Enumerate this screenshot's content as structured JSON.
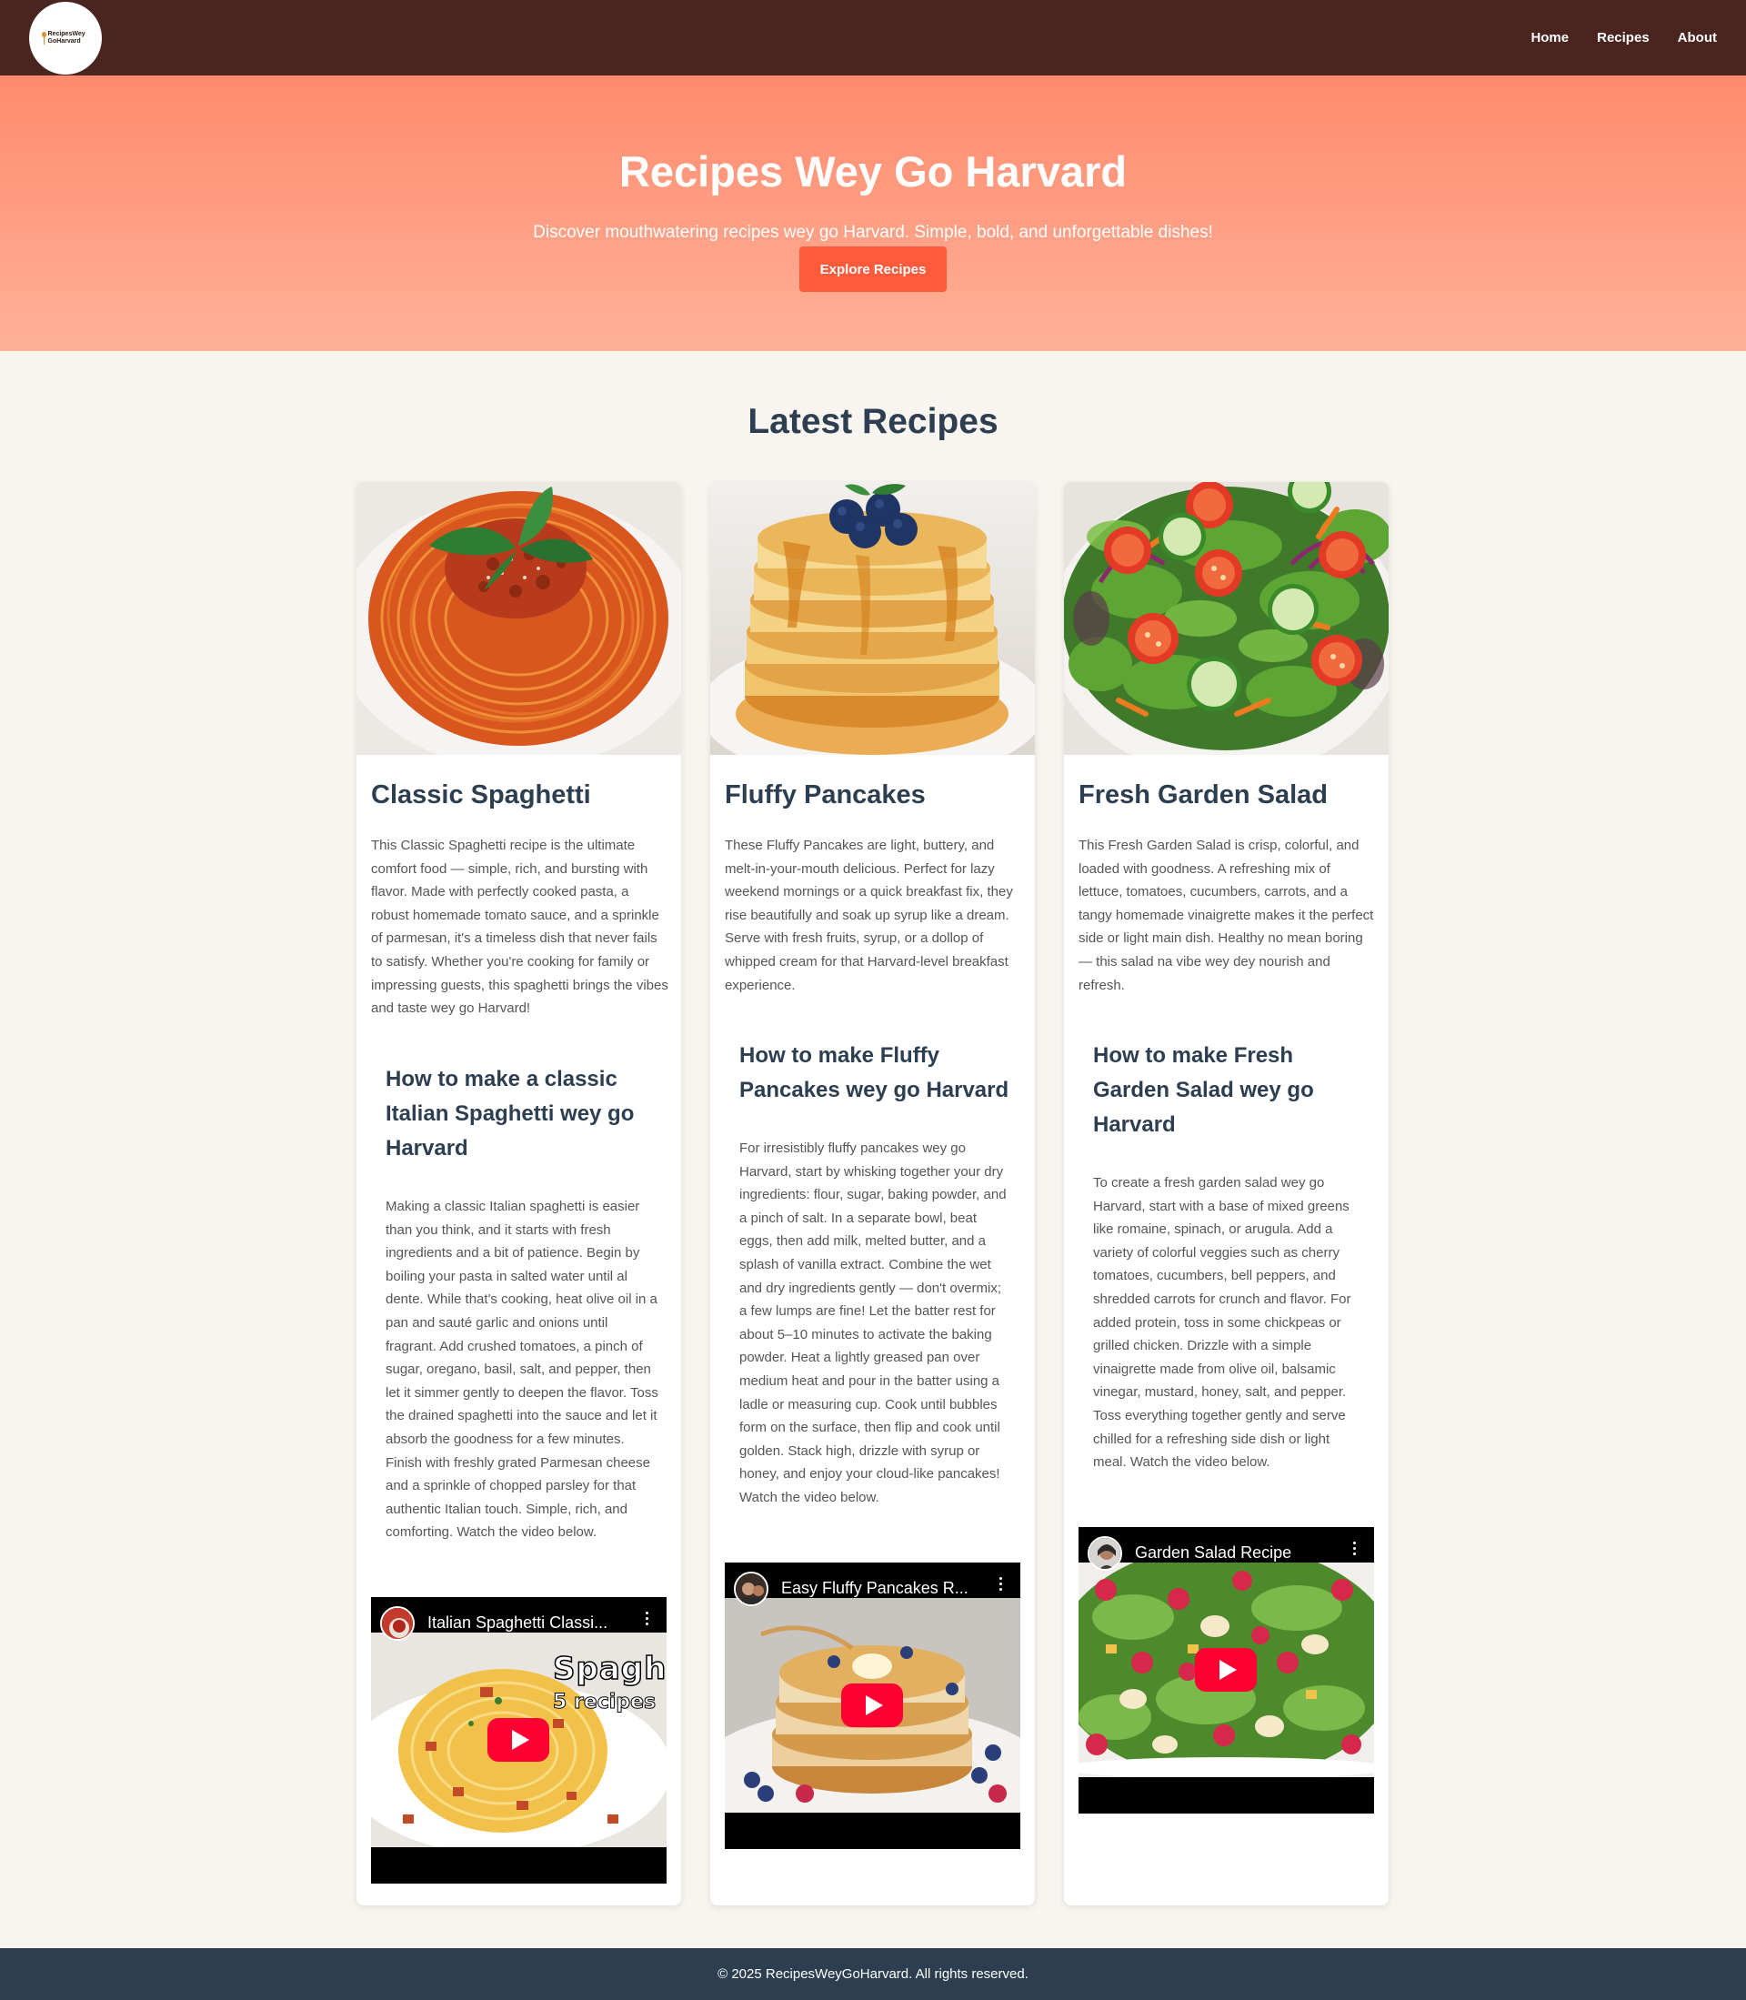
{
  "nav": {
    "logo_text": "RecipesWey GoHarvard",
    "links": [
      "Home",
      "Recipes",
      "About"
    ]
  },
  "hero": {
    "title": "Recipes Wey Go Harvard",
    "subtitle": "Discover mouthwatering recipes wey go Harvard. Simple, bold, and unforgettable dishes!",
    "cta": "Explore Recipes"
  },
  "section": {
    "title": "Latest Recipes"
  },
  "recipes": [
    {
      "title": "Classic Spaghetti",
      "description": "This Classic Spaghetti recipe is the ultimate comfort food — simple, rich, and bursting with flavor. Made with perfectly cooked pasta, a robust homemade tomato sauce, and a sprinkle of parmesan, it's a timeless dish that never fails to satisfy. Whether you're cooking for family or impressing guests, this spaghetti brings the vibes and taste wey go Harvard!",
      "how_title": "How to make a classic Italian Spaghetti wey go Harvard",
      "how_text": "Making a classic Italian spaghetti is easier than you think, and it starts with fresh ingredients and a bit of patience. Begin by boiling your pasta in salted water until al dente. While that's cooking, heat olive oil in a pan and sauté garlic and onions until fragrant. Add crushed tomatoes, a pinch of sugar, oregano, basil, salt, and pepper, then let it simmer gently to deepen the flavor. Toss the drained spaghetti into the sauce and let it absorb the goodness for a few minutes. Finish with freshly grated Parmesan cheese and a sprinkle of chopped parsley for that authentic Italian touch. Simple, rich, and comforting. Watch the video below.",
      "video_title": "Italian Spaghetti Classi...",
      "video_overlay_line1": "Spaghe",
      "video_overlay_line2": "5 recipes"
    },
    {
      "title": "Fluffy Pancakes",
      "description": "These Fluffy Pancakes are light, buttery, and melt-in-your-mouth delicious. Perfect for lazy weekend mornings or a quick breakfast fix, they rise beautifully and soak up syrup like a dream. Serve with fresh fruits, syrup, or a dollop of whipped cream for that Harvard-level breakfast experience.",
      "how_title": "How to make Fluffy Pancakes wey go Harvard",
      "how_text": "For irresistibly fluffy pancakes wey go Harvard, start by whisking together your dry ingredients: flour, sugar, baking powder, and a pinch of salt. In a separate bowl, beat eggs, then add milk, melted butter, and a splash of vanilla extract. Combine the wet and dry ingredients gently — don't overmix; a few lumps are fine! Let the batter rest for about 5–10 minutes to activate the baking powder. Heat a lightly greased pan over medium heat and pour in the batter using a ladle or measuring cup. Cook until bubbles form on the surface, then flip and cook until golden. Stack high, drizzle with syrup or honey, and enjoy your cloud-like pancakes! Watch the video below.",
      "video_title": "Easy Fluffy Pancakes R..."
    },
    {
      "title": "Fresh Garden Salad",
      "description": "This Fresh Garden Salad is crisp, colorful, and loaded with goodness. A refreshing mix of lettuce, tomatoes, cucumbers, carrots, and a tangy homemade vinaigrette makes it the perfect side or light main dish. Healthy no mean boring — this salad na vibe wey dey nourish and refresh.",
      "how_title": "How to make Fresh Garden Salad wey go Harvard",
      "how_text": "To create a fresh garden salad wey go Harvard, start with a base of mixed greens like romaine, spinach, or arugula. Add a variety of colorful veggies such as cherry tomatoes, cucumbers, bell peppers, and shredded carrots for crunch and flavor. For added protein, toss in some chickpeas or grilled chicken. Drizzle with a simple vinaigrette made from olive oil, balsamic vinegar, mustard, honey, salt, and pepper. Toss everything together gently and serve chilled for a refreshing side dish or light meal. Watch the video below.",
      "video_title": "Garden Salad Recipe"
    }
  ],
  "footer": {
    "text": "© 2025 RecipesWeyGoHarvard. All rights reserved."
  },
  "colors": {
    "nav_bg": "#4a241e",
    "hero_top": "#ff8a6d",
    "hero_bottom": "#ffb198",
    "cta": "#ff5a3a",
    "heading": "#2c3e50",
    "footer_bg": "#2c3e50",
    "play": "#ff0033"
  }
}
